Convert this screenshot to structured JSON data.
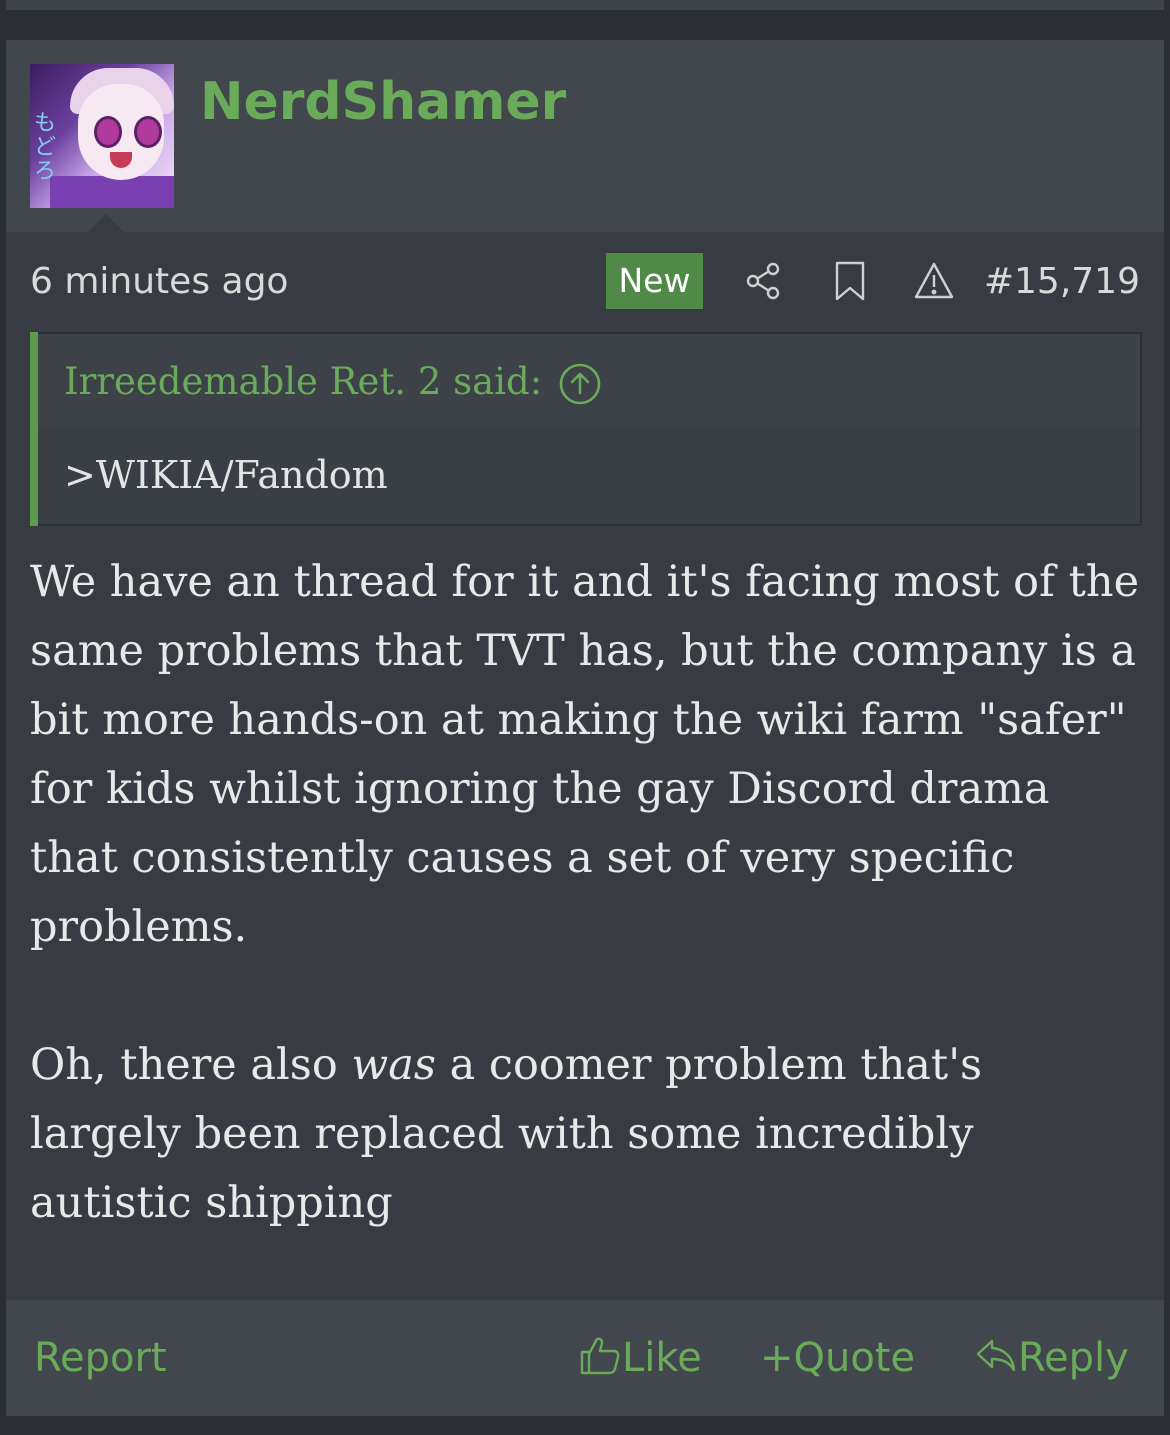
{
  "post": {
    "username": "NerdShamer",
    "avatar_alt": "anime-avatar",
    "avatar_glyph": "もどろ",
    "time": "6 minutes ago",
    "new_badge": "New",
    "post_number": "#15,719",
    "icons": [
      "share-icon",
      "bookmark-icon",
      "warning-icon"
    ]
  },
  "quote": {
    "author_line": "Irreedemable Ret. 2 said:",
    "text": ">WIKIA/Fandom"
  },
  "body": {
    "p1": "We have an thread for it and it's facing most of the same problems that TVT has, but the company is a bit more hands-on at making the wiki farm \"safer\" for kids whilst ignoring the gay Discord drama that consistently causes a set of very specific problems.",
    "p2_before": "Oh, there also ",
    "p2_em": "was",
    "p2_after": " a coomer problem that's largely been replaced with some incredibly autistic shipping"
  },
  "footer": {
    "report": "Report",
    "like": "Like",
    "quote": "Quote",
    "reply": "Reply",
    "quote_prefix": "+"
  },
  "colors": {
    "accent_green": "#6aab5a",
    "badge_green": "#4f8a47",
    "post_bg": "#383c42",
    "header_bg": "#42464d"
  }
}
